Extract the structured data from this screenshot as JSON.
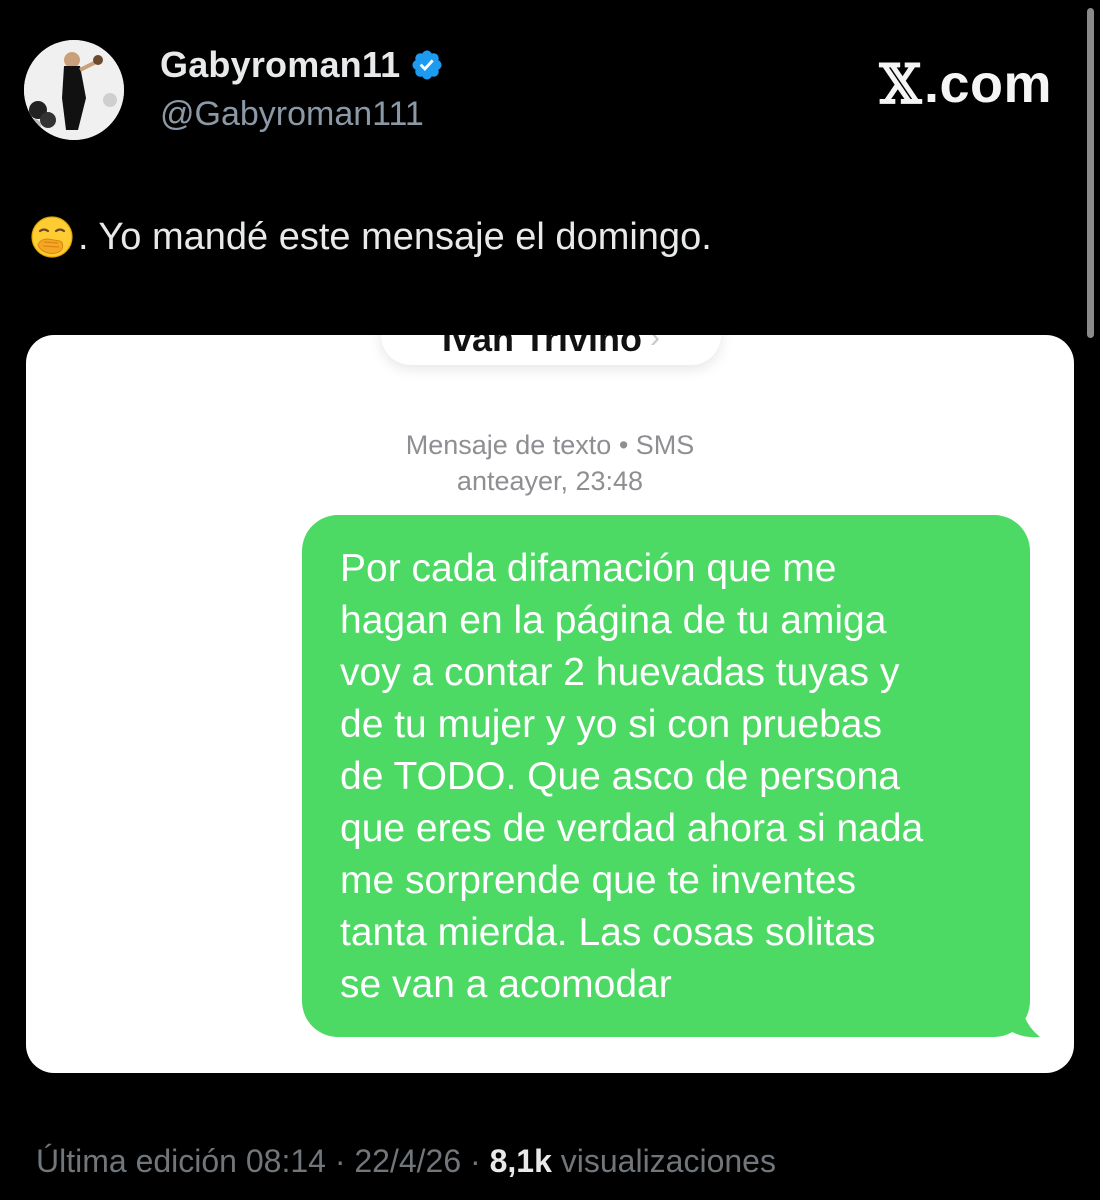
{
  "brand": {
    "name": ".com",
    "x_glyph": "𝕏",
    "color": "#f5f5f5"
  },
  "author": {
    "display_name": "Gabyroman11",
    "handle": "@Gabyroman111",
    "verified": true,
    "verified_color": "#1d9bf0"
  },
  "tweet": {
    "emoji": "yawning-face-hand-over-mouth",
    "text": ". Yo mandé este mensaje el domingo."
  },
  "screenshot": {
    "contact_name": "Ivan Triviño",
    "contact_chevron": "›",
    "meta_line_1": "Mensaje de texto • SMS",
    "meta_line_2": "anteayer, 23:48",
    "bubble_color": "#4cd964",
    "message_lines": [
      "Por cada difamación que me",
      "hagan en la página de tu amiga",
      "voy a contar 2 huevadas tuyas y",
      "de tu mujer y yo si con pruebas",
      "de TODO. Que asco de persona",
      "que eres de verdad ahora si nada",
      "me sorprende que te inventes",
      "tanta mierda. Las cosas solitas",
      "se van a acomodar"
    ]
  },
  "footer": {
    "edited_label": "Última edición 08:14 · 22/4/26",
    "separator": " · ",
    "views_count": "8,1k",
    "views_label": " visualizaciones"
  }
}
